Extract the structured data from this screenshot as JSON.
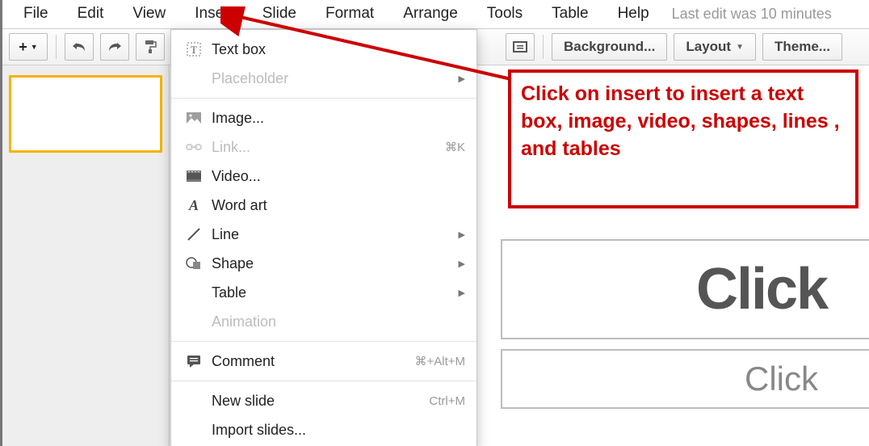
{
  "menubar": {
    "items": [
      {
        "label": "File"
      },
      {
        "label": "Edit"
      },
      {
        "label": "View"
      },
      {
        "label": "Insert"
      },
      {
        "label": "Slide"
      },
      {
        "label": "Format"
      },
      {
        "label": "Arrange"
      },
      {
        "label": "Tools"
      },
      {
        "label": "Table"
      },
      {
        "label": "Help"
      }
    ],
    "last_edit": "Last edit was 10 minutes"
  },
  "toolbar": {
    "background_label": "Background...",
    "layout_label": "Layout",
    "theme_label": "Theme..."
  },
  "insert_menu": {
    "items": [
      {
        "label": "Text box",
        "icon": "textbox",
        "enabled": true
      },
      {
        "label": "Placeholder",
        "icon": "",
        "enabled": false,
        "submenu": true
      },
      {
        "label": "Image...",
        "icon": "image",
        "enabled": true
      },
      {
        "label": "Link...",
        "icon": "link",
        "enabled": false,
        "shortcut": "⌘K"
      },
      {
        "label": "Video...",
        "icon": "video",
        "enabled": true
      },
      {
        "label": "Word art",
        "icon": "wordart",
        "enabled": true
      },
      {
        "label": "Line",
        "icon": "line",
        "enabled": true,
        "submenu": true
      },
      {
        "label": "Shape",
        "icon": "shape",
        "enabled": true,
        "submenu": true
      },
      {
        "label": "Table",
        "icon": "",
        "enabled": true,
        "submenu": true
      },
      {
        "label": "Animation",
        "icon": "",
        "enabled": false
      },
      {
        "label": "Comment",
        "icon": "comment",
        "enabled": true,
        "shortcut": "⌘+Alt+M"
      },
      {
        "label": "New slide",
        "icon": "",
        "enabled": true,
        "shortcut": "Ctrl+M"
      },
      {
        "label": "Import slides...",
        "icon": "",
        "enabled": true
      }
    ]
  },
  "callout": {
    "text": "Click on insert to insert a text box, image, video, shapes, lines , and tables"
  },
  "slide": {
    "title_placeholder": "Click",
    "subtitle_placeholder": "Click"
  }
}
